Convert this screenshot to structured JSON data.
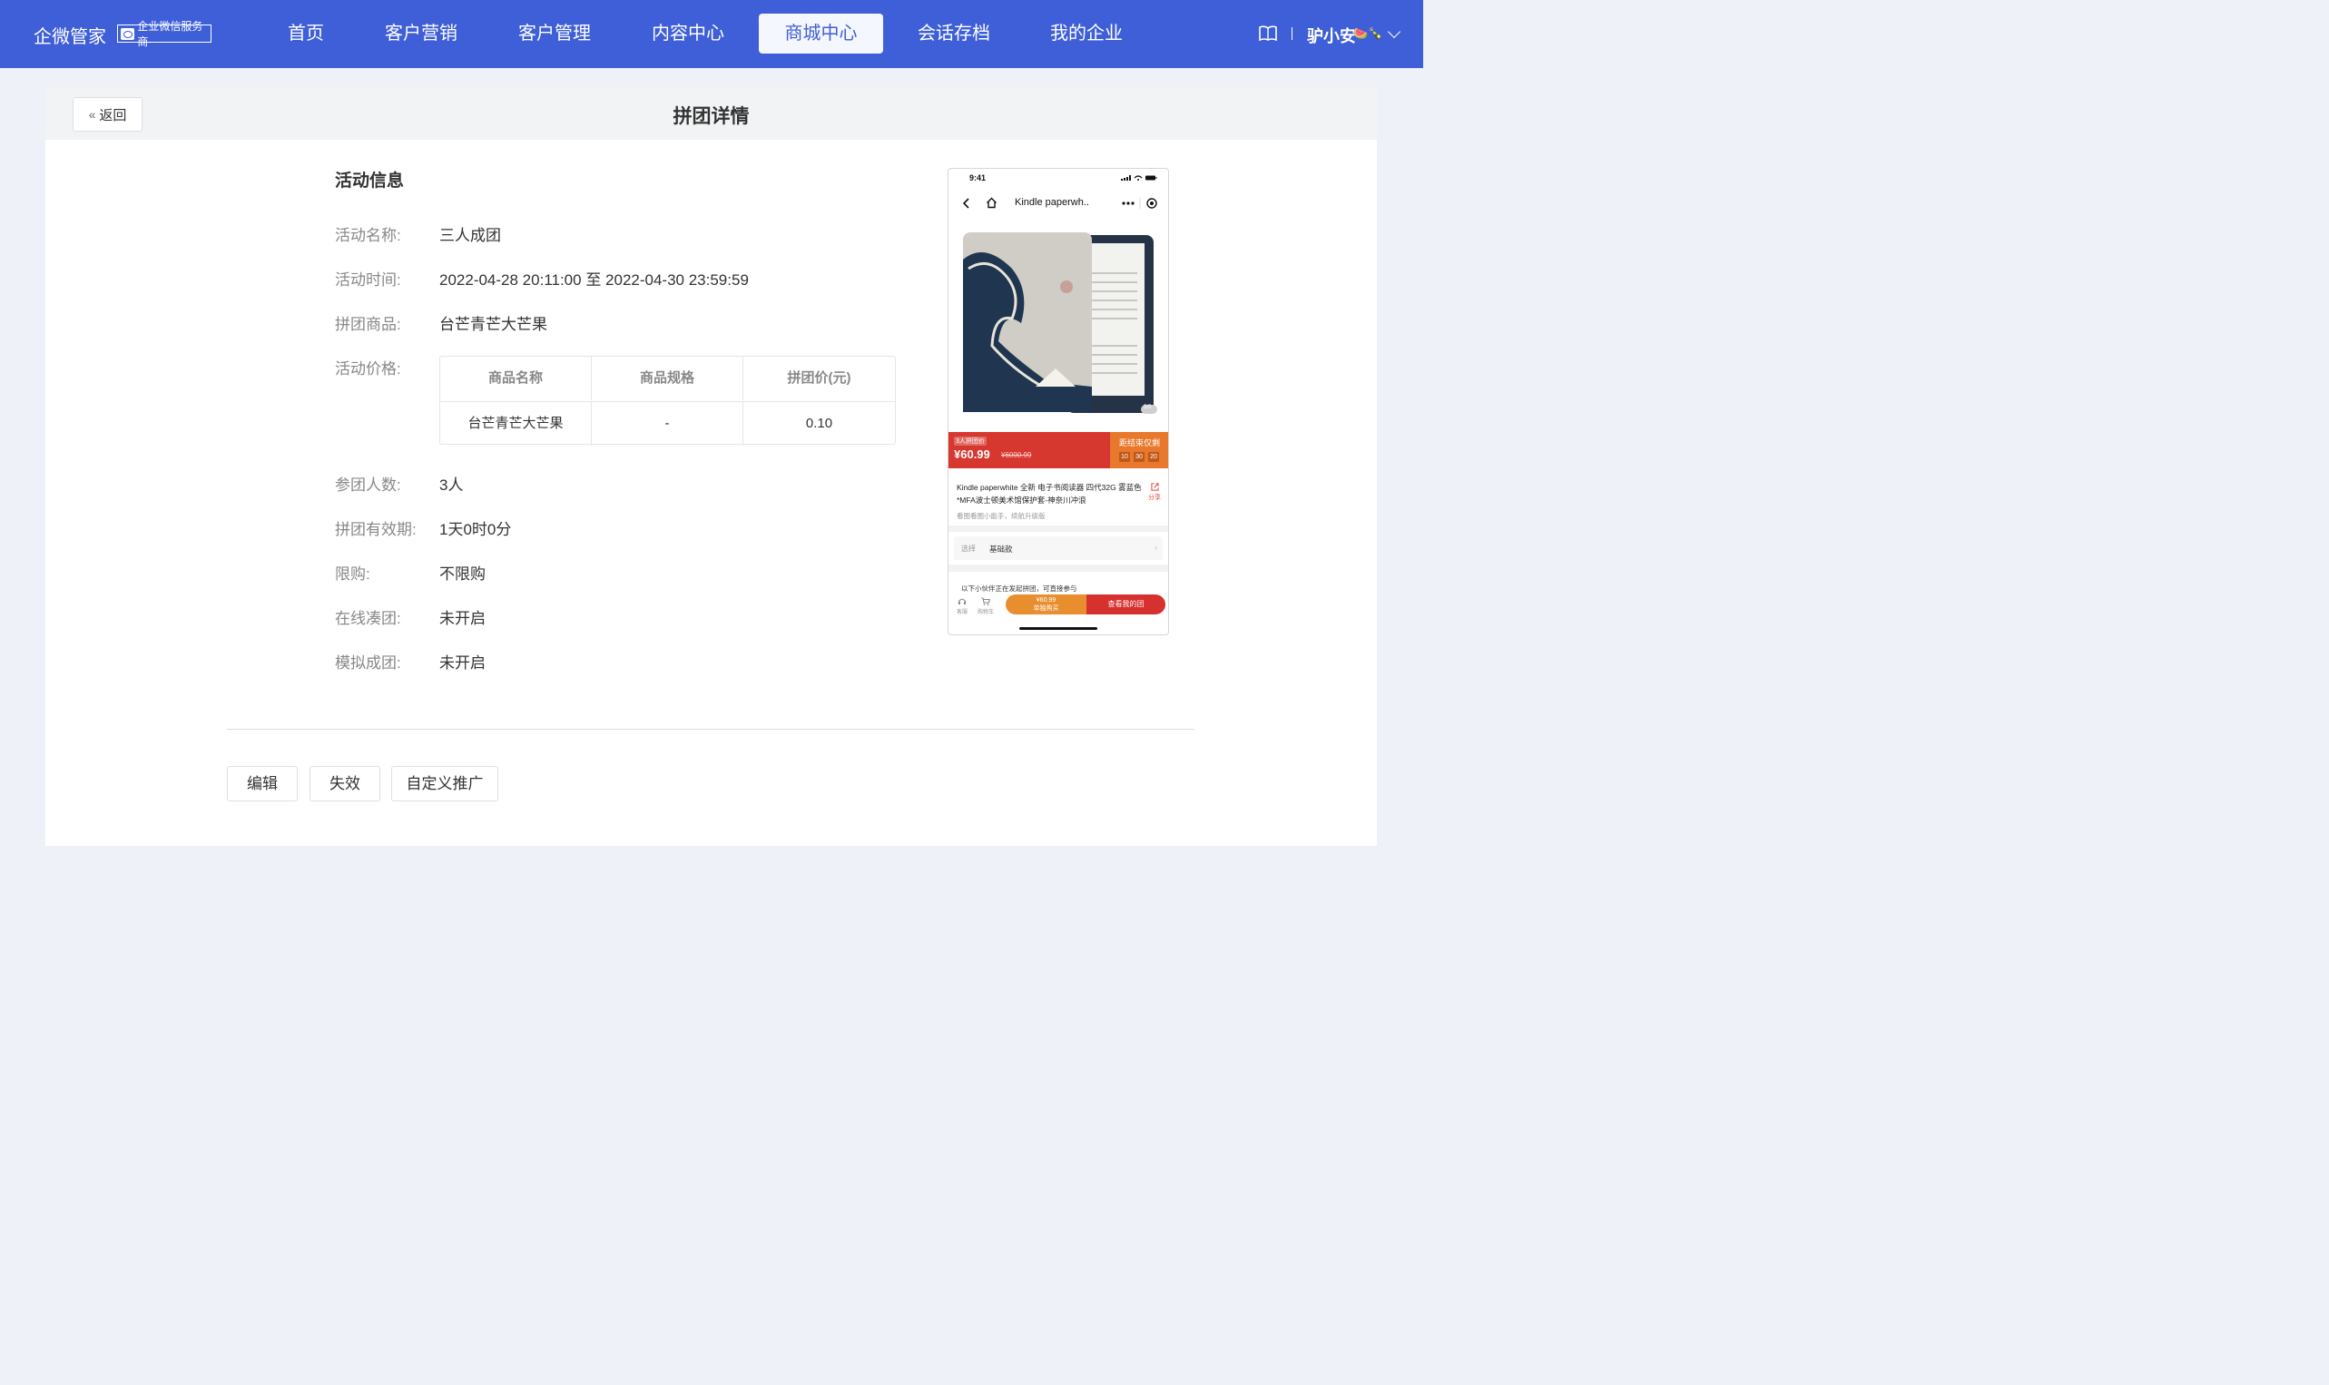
{
  "header": {
    "brand": "企微管家",
    "badge": "企业微信服务商",
    "nav": [
      {
        "label": "首页"
      },
      {
        "label": "客户营销"
      },
      {
        "label": "客户管理"
      },
      {
        "label": "内容中心"
      },
      {
        "label": "商城中心",
        "active": true
      },
      {
        "label": "会话存档"
      },
      {
        "label": "我的企业"
      }
    ],
    "username": "驴小安",
    "user_emoji": "🍉🍾"
  },
  "page": {
    "back_label": "返回",
    "title": "拼团详情"
  },
  "activity": {
    "section_title": "活动信息",
    "rows": [
      {
        "label": "活动名称:",
        "value": "三人成团"
      },
      {
        "label": "活动时间:",
        "value": "2022-04-28 20:11:00 至 2022-04-30 23:59:59"
      },
      {
        "label": "拼团商品:",
        "value": "台芒青芒大芒果"
      },
      {
        "label": "活动价格:",
        "value": ""
      },
      {
        "label": "参团人数:",
        "value": "3人"
      },
      {
        "label": "拼团有效期:",
        "value": "1天0时0分"
      },
      {
        "label": "限购:",
        "value": "不限购"
      },
      {
        "label": "在线凑团:",
        "value": "未开启"
      },
      {
        "label": "模拟成团:",
        "value": "未开启"
      }
    ],
    "price_table": {
      "headers": [
        "商品名称",
        "商品规格",
        "拼团价(元)"
      ],
      "rows": [
        [
          "台芒青芒大芒果",
          "-",
          "0.10"
        ]
      ]
    }
  },
  "actions": {
    "edit": "编辑",
    "invalidate": "失效",
    "custom_promo": "自定义推广"
  },
  "preview": {
    "time": "9:41",
    "nav_title": "Kindle paperwh..",
    "image_counter": "5/5",
    "group_tag": "3人拼团价",
    "price": "¥60.99",
    "old_price": "¥6000.99",
    "countdown_label": "距结束仅剩",
    "countdown": [
      "10",
      "30",
      "20"
    ],
    "product_title": "Kindle paperwhite 全新 电子书阅读器 四代32G 雾蓝色*MFA波士顿美术馆保护套-神奈川冲浪",
    "share": "分享",
    "subtitle": "看图看图小能手，续航升级版",
    "select_label": "选择",
    "select_value": "基础款",
    "join_text": "以下小伙伴正在发起拼团，可直接参与",
    "service": "客服",
    "cart": "购物车",
    "buy_price": "¥60.99",
    "buy_label": "单独购买",
    "team_label": "查看我的团",
    "colors": {
      "brand_blue": "#3f5fd8",
      "price_red": "#d6382f",
      "countdown_orange": "#e8782c"
    }
  }
}
